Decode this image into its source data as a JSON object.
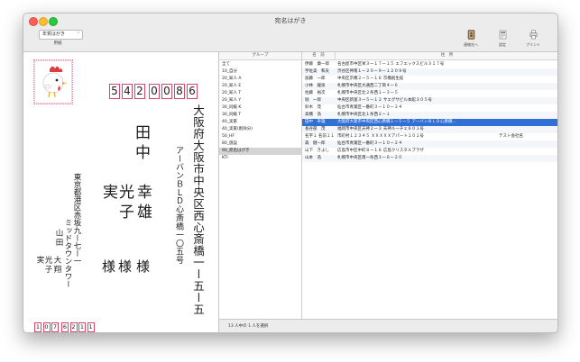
{
  "window": {
    "title": "宛名はがき"
  },
  "toolbar": {
    "view_select": "年賀はがき",
    "view_label": "用紙",
    "buttons": [
      {
        "label": "連絡先へ",
        "icon": "contacts-book-icon"
      },
      {
        "label": "設定",
        "icon": "settings-sheet-icon"
      },
      {
        "label": "プリント",
        "icon": "printer-icon"
      }
    ]
  },
  "card": {
    "postal_code": [
      "5",
      "4",
      "2",
      "0",
      "0",
      "8",
      "6"
    ],
    "recipient_address_line1": "大阪府大阪市中央区西心斎橋一ー五ー五",
    "recipient_address_line2": "アーバンＢＬＤ心斎橋一〇五号",
    "recipient_surname": "田中",
    "recipient_given_1": "幸雄",
    "recipient_given_2": "光子",
    "recipient_surname_2": "実",
    "honorifics": [
      "様",
      "様",
      "様"
    ],
    "sender_address_line1": "東京都港区赤坂九ー七ー一",
    "sender_address_line2": "ミッドタウンタワー",
    "sender_surname": "山田",
    "sender_given_1": "大翔",
    "sender_given_2": "光子",
    "sender_surname_2": "実",
    "sender_postal_code": [
      "1",
      "0",
      "7",
      "6",
      "2",
      "1",
      "1"
    ]
  },
  "groups": {
    "header": "グループ",
    "items": [
      {
        "label": "全て"
      },
      {
        "label": "10_自分"
      },
      {
        "label": "20_知人 A"
      },
      {
        "label": "20_知人 E"
      },
      {
        "label": "20_知人 T"
      },
      {
        "label": "20_知人 Y"
      },
      {
        "label": "30_同級 K"
      },
      {
        "label": "30_同級 T"
      },
      {
        "label": "40_実家"
      },
      {
        "label": "40_実家(削除分)"
      },
      {
        "label": "50_HF"
      },
      {
        "label": "80_施設"
      },
      {
        "label": "90_宛名はがき",
        "selected": true
      },
      {
        "label": "KTI"
      }
    ]
  },
  "contacts": {
    "header_name": "名　前",
    "header_address": "住　所",
    "rows": [
      {
        "name": "伊藤　康一郎",
        "address": "名古屋市中区栄３ー１７ー１５ エフエックスビル３１７号"
      },
      {
        "name": "宇佐美　和夫",
        "address": "渋谷区神南１ー２０ー９ー１２０９号"
      },
      {
        "name": "加藤　一郎",
        "address": "中央区京橋２ー５ー１８ 京橋創生館"
      },
      {
        "name": "小林　龍泉",
        "address": "札幌市中央区大通西二丁目４ー６"
      },
      {
        "name": "佐藤　裕次",
        "address": "札幌市中央区北２条西１ー３ー５"
      },
      {
        "name": "堀　一郎",
        "address": "中央区新富３ー５ー１２ サエグサビル本館３０５号"
      },
      {
        "name": "鈴木　茂",
        "address": "仙台市青葉区一番町３ー１０ー２４"
      },
      {
        "name": "高橋　浩",
        "address": "札幌市中央区北１条西２ー１"
      },
      {
        "name": "田中　幸雄",
        "address": "大阪府大阪市中央区西心斎橋１ー５ー５ アーバンＢＬＤ心斎橋...",
        "selected": true
      },
      {
        "name": "長谷部　茂",
        "address": "福岡市中央区天神２ー３ 天神ルーチェ８０１号"
      },
      {
        "name": "名字１ 名前１１",
        "address": "市町村１２３４５ ＸＸＸＸＸアパート１０１号",
        "extra": "テスト会社名"
      },
      {
        "name": "森　健一郎",
        "address": "仙台市青葉区一番町３ー１０ー２４"
      },
      {
        "name": "山下　きよし",
        "address": "広島市中区中町８ー１８ 広島クリスタルプラザ"
      },
      {
        "name": "山本　浩",
        "address": "札幌市中央区南一条西３ー８ー２０"
      }
    ]
  },
  "status": {
    "text": "13 人中の 1 人を選択"
  },
  "colors": {
    "accent": "#2f6fd6",
    "postal_box": "#d8466e"
  }
}
